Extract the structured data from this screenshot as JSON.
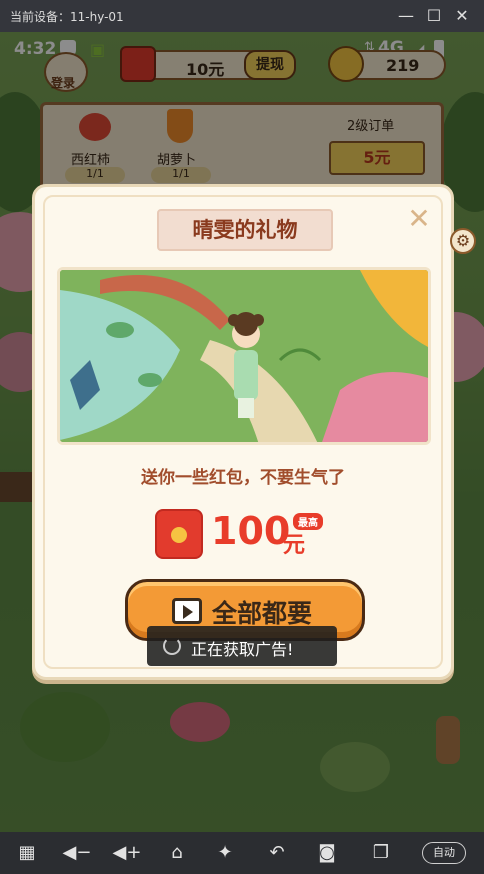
{
  "emulator": {
    "title": "当前设备：11-hy-01",
    "auto_label": "自动"
  },
  "status": {
    "time": "4:32",
    "network": "4G"
  },
  "topbar": {
    "login_label": "登录",
    "cash_value": "10元",
    "withdraw_label": "提现",
    "coin_value": "219"
  },
  "order_board": {
    "items": [
      {
        "name": "西红柿",
        "progress": "1/1"
      },
      {
        "name": "胡萝卜",
        "progress": "1/1"
      }
    ],
    "level_label": "2级订单",
    "reward": "5元"
  },
  "dialog": {
    "title": "晴雯的礼物",
    "message": "送你一些红包，不要生气了",
    "reward_amount": "100",
    "reward_unit": "元",
    "reward_badge": "最高",
    "claim_label": "全部都要"
  },
  "toast": {
    "text": "正在获取广告!"
  },
  "colors": {
    "accent_orange": "#f39a36",
    "reward_red": "#e83c2a",
    "title_brown": "#8a3a1e"
  }
}
